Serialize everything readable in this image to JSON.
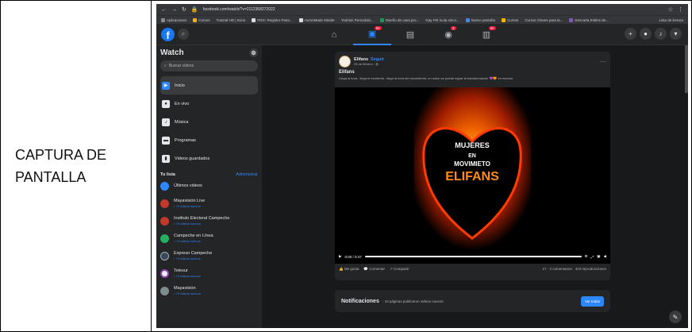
{
  "caption": "CAPTURA DE\nPANTALLA",
  "browser": {
    "url": "facebook.com/watch/?v=2112368272022",
    "bookmarks": [
      "Aplicaciones",
      "Cursos",
      "Tutorial HD | Inicio",
      "PDG: Registro Pasa...",
      "HomeMade Minder",
      "Yoshimi Perezdolo...",
      "Diseño de casa pro...",
      "Gay Pel·ícula sinco...",
      "Nuevo pestaña",
      "Cursos",
      "Cursos Claves para la...",
      "Descarta Estilos de..."
    ],
    "reading_list": "Lista de lectura"
  },
  "colors": {
    "accent": "#2d88ff",
    "bg": "#18191a",
    "surface": "#242526",
    "badge": "#e41e3f"
  },
  "header": {
    "logo": "f",
    "tab_badges": [
      "",
      "9+",
      "",
      "3",
      "9+"
    ]
  },
  "sidebar": {
    "title": "Watch",
    "search_placeholder": "Buscar videos",
    "menu": [
      {
        "label": "Inicio",
        "icon": "▶"
      },
      {
        "label": "En vivo",
        "icon": "●"
      },
      {
        "label": "Música",
        "icon": "♪"
      },
      {
        "label": "Programas",
        "icon": "▬"
      },
      {
        "label": "Videos guardados",
        "icon": "▮"
      }
    ],
    "list_title": "Tu lista",
    "admin_label": "Administrar",
    "list": [
      {
        "name": "Últimos videos",
        "sub": "",
        "color": "#2d88ff"
      },
      {
        "name": "Mayavisión Live",
        "sub": "• +9 videos nuevos",
        "color": "#c0392b"
      },
      {
        "name": "Instituto Electoral Campeche",
        "sub": "• +9 videos nuevos",
        "color": "#c0392b"
      },
      {
        "name": "Campeche en Línea",
        "sub": "• +9 videos nuevos",
        "color": "#27ae60"
      },
      {
        "name": "Expreso Campeche",
        "sub": "• +9 videos nuevos",
        "color": "#34495e"
      },
      {
        "name": "Telesur",
        "sub": "• +9 videos nuevos",
        "color": "#ecf0f1"
      },
      {
        "name": "Mayavisión",
        "sub": "• +9 videos nuevos",
        "color": "#7f8c8d"
      }
    ]
  },
  "post": {
    "author": "Elifans",
    "follow": "Seguir",
    "date": "25 de febrero · ◍",
    "title": "Elifans",
    "text": "Llega la hora.. llega el momento.. llega la hora del movimiento, en union se puede lograr la transformación 💜🧡 en nuevos",
    "video_line1": "MUJERES",
    "video_line2": "EN",
    "video_line3": "MOVIMIETO",
    "video_brand": "ELIFANS",
    "time": "0:00 / 0:47",
    "actions": [
      "Me gusta",
      "Comentar",
      "Compartir"
    ],
    "stats": "17 · 2 comentarios · 4ml reproducciones"
  },
  "notification": {
    "title": "Notificaciones",
    "desc": "· 10 páginas publicaron videos nuevos",
    "button": "Ver todas"
  }
}
